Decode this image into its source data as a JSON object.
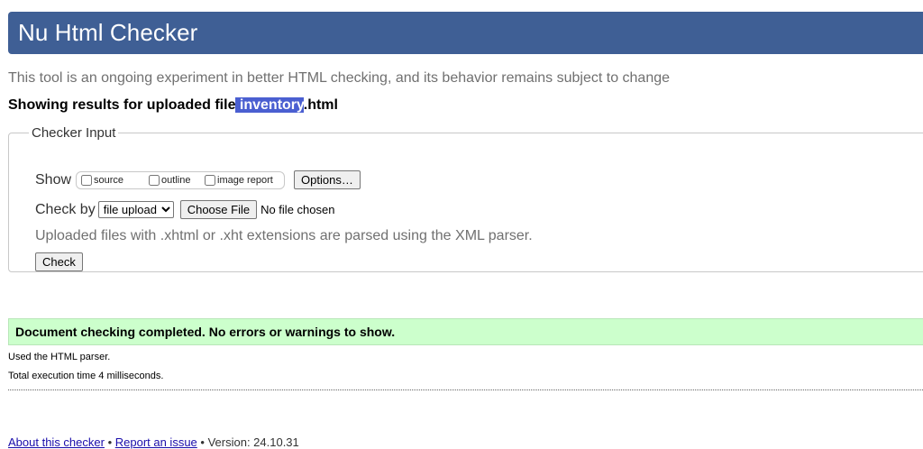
{
  "header": {
    "title": "Nu Html Checker"
  },
  "subtitle": "This tool is an ongoing experiment in better HTML checking, and its behavior remains subject to change",
  "results": {
    "prefix": "Showing results for uploaded file",
    "filename": " inventory",
    "extension": ".html"
  },
  "checker_input": {
    "legend": "Checker Input",
    "show_label": "Show",
    "show_options": [
      {
        "label": "source",
        "checked": false
      },
      {
        "label": "outline",
        "checked": false
      },
      {
        "label": "image report",
        "checked": false
      }
    ],
    "options_button": "Options…",
    "check_by_label": "Check by",
    "check_by_selected": "file upload",
    "choose_file_button": "Choose File",
    "no_file_text": "No file chosen",
    "note": "Uploaded files with .xhtml or .xht extensions are parsed using the XML parser.",
    "check_button": "Check"
  },
  "status": {
    "message": "Document checking completed. No errors or warnings to show.",
    "color": "#ccffcc"
  },
  "meta": {
    "parser": "Used the HTML parser.",
    "execution": "Total execution time 4 milliseconds."
  },
  "footer": {
    "about_link": "About this checker",
    "separator1": " • ",
    "report_link": "Report an issue",
    "separator2": " • ",
    "version": "Version: 24.10.31"
  },
  "colors": {
    "header_bg": "#3f5f95",
    "highlight": "#4a5fd1",
    "link": "#1a0dab"
  }
}
